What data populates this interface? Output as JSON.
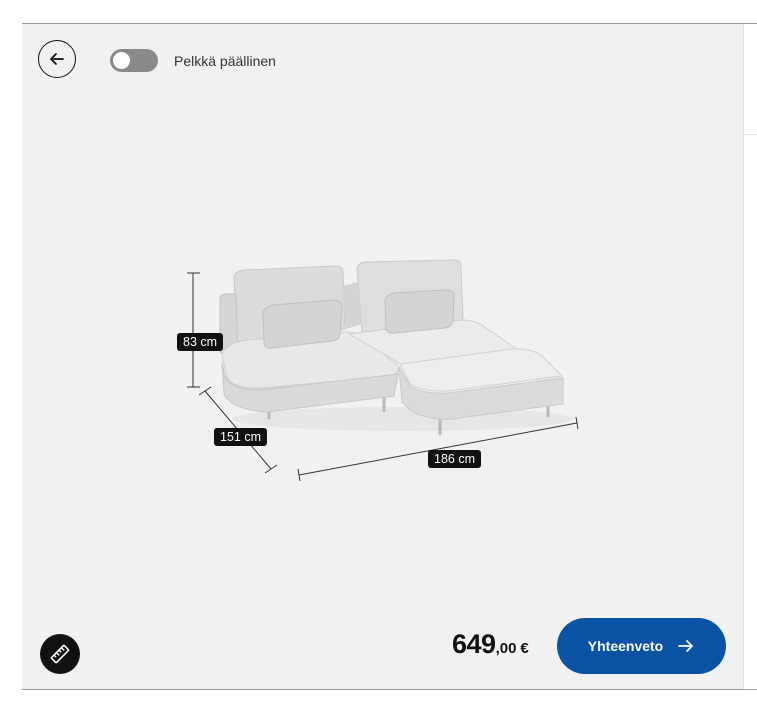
{
  "toolbar": {
    "toggle_label": "Pelkkä päällinen",
    "toggle_on": false
  },
  "dimensions": {
    "height": "83 cm",
    "depth": "151 cm",
    "width": "186 cm"
  },
  "footer": {
    "price_integer": "649",
    "price_decimal": ",00",
    "currency": "€",
    "summary_label": "Yhteenveto"
  },
  "colors": {
    "canvas_bg": "#f1f1f1",
    "accent_button": "#0a52a3",
    "toggle_off": "#8a8a8a",
    "label_bg": "#111111"
  },
  "icons": {
    "back": "arrow-left-icon",
    "measure": "ruler-icon",
    "summary": "arrow-right-icon"
  }
}
